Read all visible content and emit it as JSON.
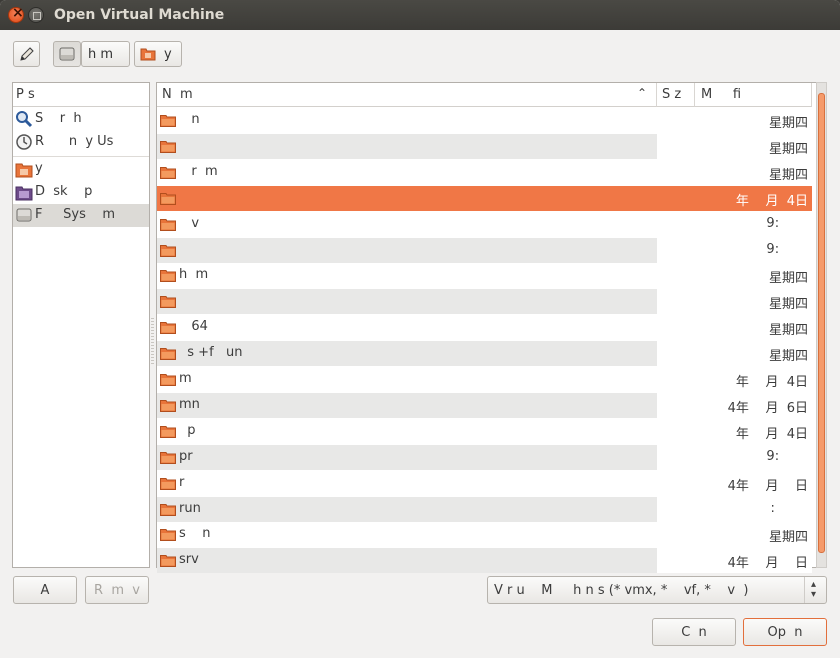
{
  "window": {
    "title": "Open Virtual Machine"
  },
  "toolbar": {
    "home_label": "h m",
    "folder_label": "y"
  },
  "places": {
    "header": "P      s",
    "items": [
      {
        "label": "S    r  h",
        "icon": "search-icon"
      },
      {
        "label": "R      n  y Us",
        "icon": "recent-clock-icon"
      },
      {
        "label": "y",
        "icon": "folder-home-icon"
      },
      {
        "label": "D  sk    p",
        "icon": "desktop-icon"
      },
      {
        "label": "F     Sys    m",
        "icon": "harddisk-icon"
      }
    ],
    "add_label": "A",
    "remove_label": "R  m  v"
  },
  "files": {
    "columns": {
      "name": "N  m",
      "size": "S z",
      "modified": "M     fi"
    },
    "rows": [
      {
        "name": "   n",
        "modified": "星期四"
      },
      {
        "name": "",
        "modified": "星期四"
      },
      {
        "name": "   r  m",
        "modified": "星期四"
      },
      {
        "name": "",
        "modified": "年    月  4日"
      },
      {
        "name": "   v",
        "modified": "9:       "
      },
      {
        "name": "",
        "modified": "9:       "
      },
      {
        "name": "h  m",
        "modified": "星期四"
      },
      {
        "name": "",
        "modified": "星期四"
      },
      {
        "name": "   64",
        "modified": "星期四"
      },
      {
        "name": "  s +f   un",
        "modified": "星期四"
      },
      {
        "name": "m",
        "modified": "年    月  4日"
      },
      {
        "name": "mn",
        "modified": "4年    月  6日"
      },
      {
        "name": "  p",
        "modified": "年    月  4日"
      },
      {
        "name": "pr",
        "modified": "9:       "
      },
      {
        "name": "r",
        "modified": "4年    月    日"
      },
      {
        "name": "run",
        "modified": ":        "
      },
      {
        "name": "s    n",
        "modified": "星期四"
      },
      {
        "name": "srv",
        "modified": "4年    月    日"
      }
    ]
  },
  "filter": {
    "value": "V r u    M     h n s (* vmx, *    vf, *    v  )"
  },
  "actions": {
    "cancel_label": "C  n",
    "open_label": "Op  n"
  },
  "colors": {
    "accent": "#f07746",
    "folder": "#e8743a"
  }
}
